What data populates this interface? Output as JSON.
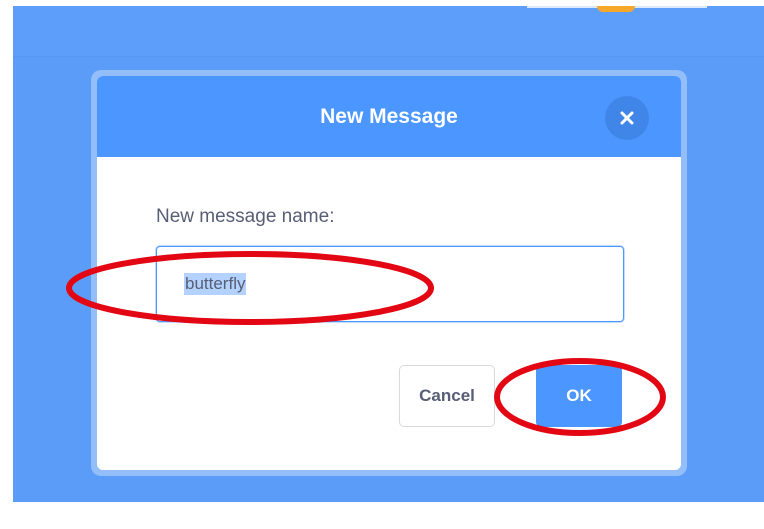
{
  "dialog": {
    "title": "New Message",
    "field_label": "New message name:",
    "input_value": "butterfly",
    "cancel_label": "Cancel",
    "ok_label": "OK",
    "close_icon": "close-icon"
  },
  "colors": {
    "stage_blue": "#5a9cf8",
    "header_blue": "#4c97ff",
    "annotation_red": "#e30613",
    "selection": "#b3d2ff"
  },
  "annotations": {
    "highlight_count": 2,
    "highlighted_targets": [
      "name-input",
      "ok-button"
    ]
  }
}
